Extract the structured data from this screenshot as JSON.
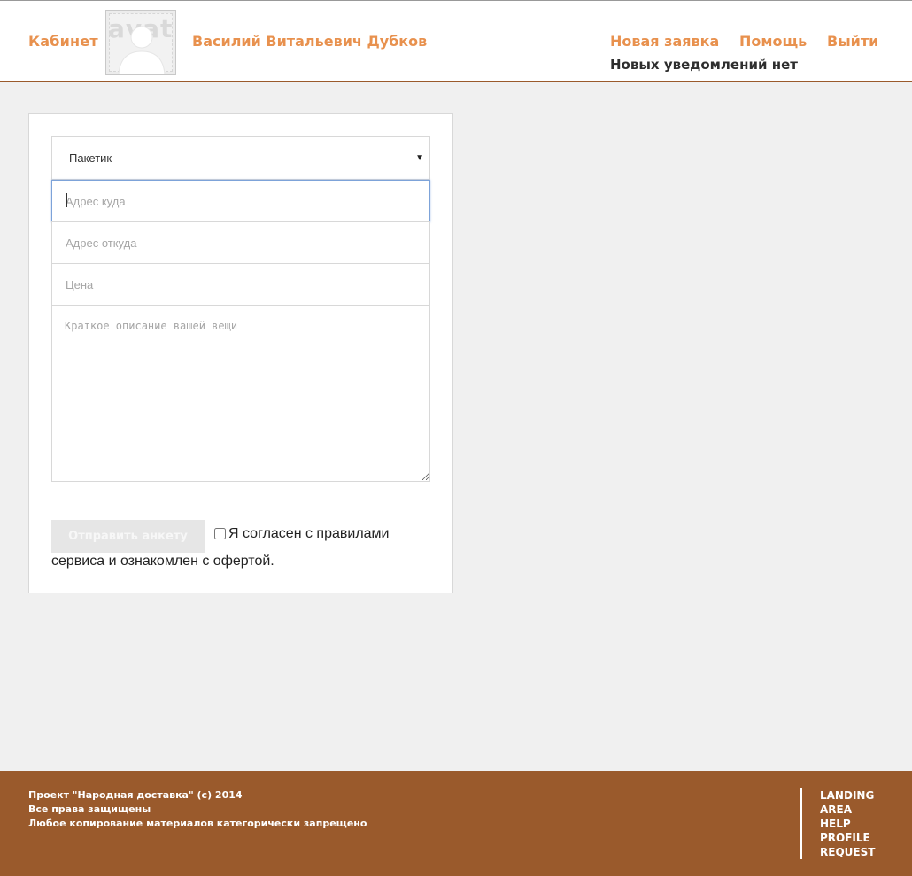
{
  "header": {
    "cabinet_label": "Кабинет",
    "avatar_text": "avat",
    "user_name": "Василий Витальевич Дубков",
    "nav": {
      "new_request": "Новая заявка",
      "help": "Помощь",
      "logout": "Выйти"
    },
    "notifications": "Новых уведомлений нет"
  },
  "form": {
    "type_select": {
      "selected": "Пакетик"
    },
    "address_to": {
      "placeholder": "Адрес куда",
      "value": ""
    },
    "address_from": {
      "placeholder": "Адрес откуда",
      "value": ""
    },
    "price": {
      "placeholder": "Цена",
      "value": ""
    },
    "description": {
      "placeholder": "Краткое описание вашей вещи",
      "value": ""
    },
    "submit_label": "Отправить анкету",
    "agree_line1": "Я согласен с правилами",
    "agree_line2": "сервиса и ознакомлен с офертой.",
    "agree_checked": false
  },
  "footer": {
    "copyright_lines": [
      "Проект \"Народная доставка\" (c) 2014",
      "Все права защищены",
      "Любое копирование материалов категорически запрещено"
    ],
    "links": [
      "LANDING",
      "AREA",
      "HELP",
      "PROFILE",
      "REQUEST"
    ]
  },
  "colors": {
    "accent_orange": "#e8914e",
    "footer_brown": "#9a5a2c",
    "page_background": "#f0f0f0",
    "focus_blue": "#7da3d9"
  }
}
